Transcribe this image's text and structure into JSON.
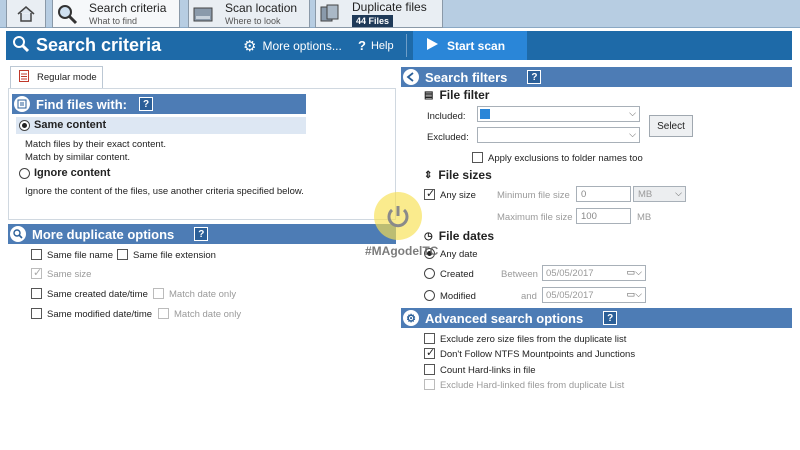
{
  "tabs": [
    {
      "title": "",
      "subtitle": ""
    },
    {
      "title": "Search criteria",
      "subtitle": "What to find"
    },
    {
      "title": "Scan location",
      "subtitle": "Where to look"
    },
    {
      "title": "Duplicate files",
      "badge": "44 Files"
    }
  ],
  "header": {
    "title": "Search criteria",
    "more_options": "More options...",
    "help": "Help",
    "start_scan": "Start scan"
  },
  "mode_tab": "Regular mode",
  "find_files": {
    "title": "Find files with:",
    "help_badge": "?",
    "same_content": "Same content",
    "same_content_desc1": "Match files by their exact content.",
    "same_content_desc2": "Match by similar content.",
    "ignore_content": "Ignore content",
    "ignore_content_desc": "Ignore the content of the files, use another criteria specified below."
  },
  "more_dup": {
    "title": "More duplicate options",
    "help_badge": "?",
    "same_file_name": "Same file name",
    "same_file_ext": "Same file extension",
    "same_size": "Same size",
    "same_created": "Same created date/time",
    "match_date_1": "Match date only",
    "same_modified": "Same modified date/time",
    "match_date_2": "Match date only"
  },
  "filters": {
    "title": "Search filters",
    "help_badge": "?",
    "file_filter": "File filter",
    "included_label": "Included:",
    "excluded_label": "Excluded:",
    "select_button": "Select",
    "apply_exclusions": "Apply exclusions to folder names too",
    "file_sizes": "File sizes",
    "any_size": "Any size",
    "min_size_label": "Minimum file size",
    "min_size_value": "0",
    "min_unit": "MB",
    "max_size_label": "Maximum file size",
    "max_size_value": "100",
    "max_unit": "MB",
    "file_dates": "File dates",
    "any_date": "Any date",
    "created": "Created",
    "between": "Between",
    "created_date": "05/05/2017",
    "modified": "Modified",
    "and": "and",
    "modified_date": "05/05/2017"
  },
  "advanced": {
    "title": "Advanced search options",
    "help_badge": "?",
    "opt1": "Exclude zero size files from the duplicate list",
    "opt2": "Don't Follow NTFS Mountpoints and Junctions",
    "opt3": "Count Hard-links in file",
    "opt4": "Exclude Hard-linked files from duplicate List"
  },
  "watermark": "#MAgodelTC",
  "colors": {
    "header_blue": "#1e6aa8",
    "section_blue": "#4d7cb5",
    "start_scan_blue": "#2a86d8",
    "tabbar_bg": "#b7cde2"
  }
}
